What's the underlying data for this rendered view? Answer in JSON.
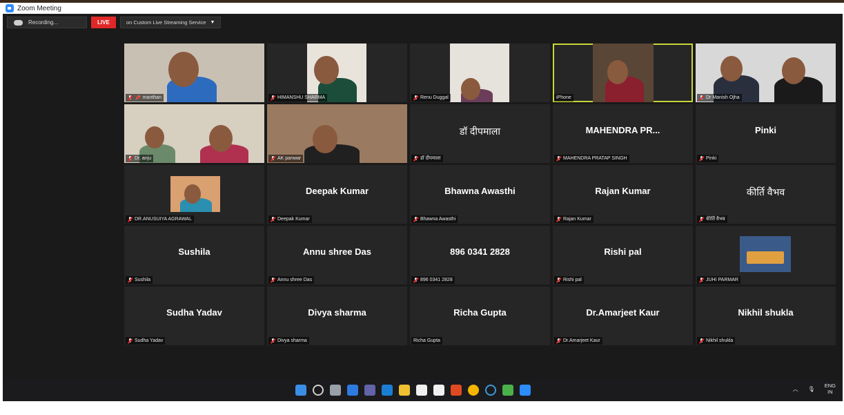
{
  "window": {
    "title": "Zoom Meeting"
  },
  "toolbar": {
    "recording_label": "Recording...",
    "live_label": "LIVE",
    "stream_label": "on Custom Live Streaming Service"
  },
  "participants": [
    {
      "label": "manthan",
      "video": true,
      "muted": true,
      "pinned": true
    },
    {
      "label": "HIMANSHU SHARMA",
      "video": true,
      "muted": true
    },
    {
      "label": "Renu Duggal",
      "video": true,
      "muted": true
    },
    {
      "label": "iPhone",
      "video": true,
      "muted": false,
      "active_speaker": true
    },
    {
      "label": "Dr Manish Ojha",
      "video": true,
      "muted": true
    },
    {
      "label": "Dr. anju",
      "video": true,
      "muted": true
    },
    {
      "label": "AK panwar",
      "video": true,
      "muted": true
    },
    {
      "label": "डॉ दीपमाला",
      "display": "डॉ दीपमाला",
      "muted": true,
      "hindi": true
    },
    {
      "label": "MAHENDRA PRATAP SINGH",
      "display": "MAHENDRA PR...",
      "muted": true
    },
    {
      "label": "Pinki",
      "display": "Pinki",
      "muted": true
    },
    {
      "label": "DR.ANUSUIYA AGRAWAL",
      "video": true,
      "muted": true
    },
    {
      "label": "Deepak Kumar",
      "display": "Deepak Kumar",
      "muted": true
    },
    {
      "label": "Bhawna Awasthi",
      "display": "Bhawna Awasthi",
      "muted": true
    },
    {
      "label": "Rajan Kumar",
      "display": "Rajan Kumar",
      "muted": true
    },
    {
      "label": "कीर्ति वैभव",
      "display": "कीर्ति वैभव",
      "muted": true,
      "hindi": true
    },
    {
      "label": "Sushila",
      "display": "Sushila",
      "muted": true
    },
    {
      "label": "Annu shree Das",
      "display": "Annu shree Das",
      "muted": true
    },
    {
      "label": "896 0341 2828",
      "display": "896 0341 2828",
      "muted": true
    },
    {
      "label": "Rishi pal",
      "display": "Rishi pal",
      "muted": true
    },
    {
      "label": "JUHI PARMAR",
      "video": true,
      "muted": true
    },
    {
      "label": "Sudha Yadav",
      "display": "Sudha Yadav",
      "muted": true
    },
    {
      "label": "Divya sharma",
      "display": "Divya sharma",
      "muted": true
    },
    {
      "label": "Richa Gupta",
      "display": "Richa Gupta",
      "muted": false
    },
    {
      "label": "Dr.Amarjeet Kaur",
      "display": "Dr.Amarjeet Kaur",
      "muted": true
    },
    {
      "label": "Nikhil shukla",
      "display": "Nikhil shukla",
      "muted": true
    }
  ],
  "taskbar": {
    "icons": [
      "windows-start-icon",
      "search-icon",
      "task-view-icon",
      "widgets-icon",
      "teams-chat-icon",
      "mail-icon",
      "file-explorer-icon",
      "winamp-icon",
      "dropbox-icon",
      "office-icon",
      "chrome-icon",
      "cortana-icon",
      "paint-icon",
      "zoom-icon"
    ],
    "tray_lang": "ENG",
    "tray_region": "IN"
  },
  "colors": {
    "live_red": "#e02828",
    "active_speaker_border": "#c8d83a",
    "tile_bg": "#262626",
    "meeting_bg": "#1a1a1a"
  }
}
